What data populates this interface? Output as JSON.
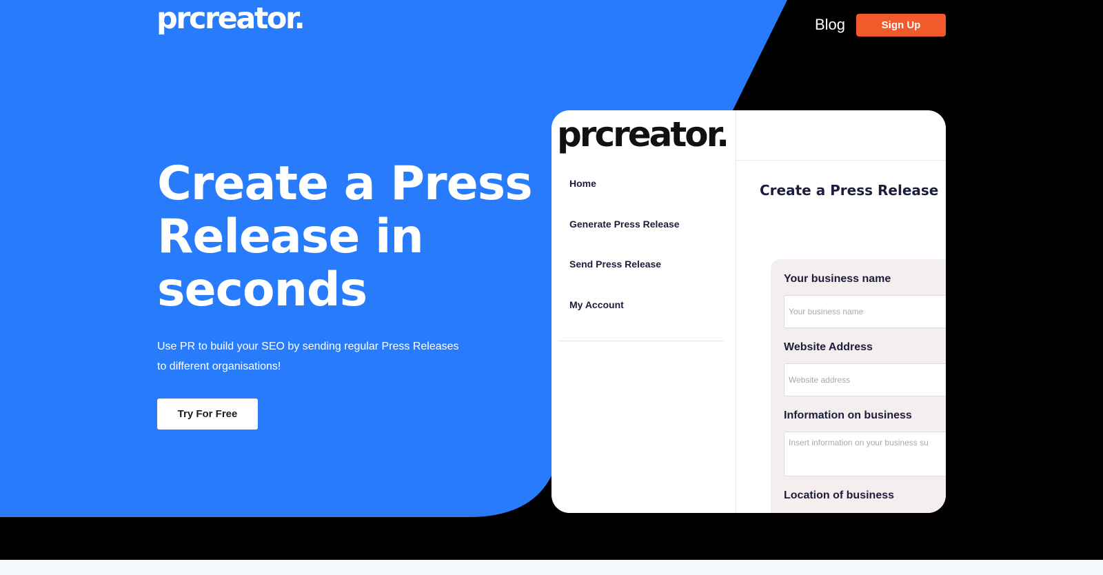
{
  "header": {
    "logo": "prcreator.",
    "nav_blog": "Blog",
    "signup_label": "Sign Up"
  },
  "hero": {
    "headline_line1": "Create a Press",
    "headline_line2": "Release in",
    "headline_line3": "seconds",
    "subtext": "Use PR to build your SEO by sending regular Press Releases to different organisations!",
    "cta_label": "Try For Free"
  },
  "app_preview": {
    "logo": "prcreator.",
    "nav": [
      {
        "label": "Home"
      },
      {
        "label": "Generate Press Release"
      },
      {
        "label": "Send Press Release"
      },
      {
        "label": "My Account"
      }
    ],
    "title": "Create a Press Release",
    "form": {
      "business_name_label": "Your business name",
      "business_name_placeholder": "Your business name",
      "website_label": "Website Address",
      "website_placeholder": "Website address",
      "info_label": "Information on business",
      "info_placeholder": "Insert information on your business su",
      "location_label": "Location of business"
    }
  },
  "colors": {
    "brand_blue": "#287cfc",
    "signup_orange": "#f25a2b",
    "dark_text": "#1b1d3a"
  }
}
